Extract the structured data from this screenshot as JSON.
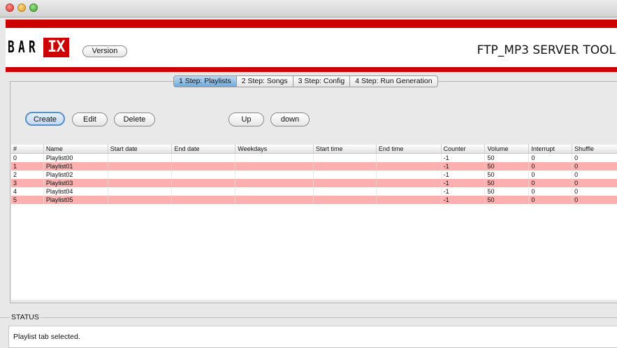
{
  "header": {
    "logo_letters": [
      "B",
      "A",
      "R"
    ],
    "logo_highlight": "IX",
    "version_label": "Version",
    "title": "FTP_MP3 SERVER TOOL"
  },
  "tabs": [
    {
      "label": "1 Step: Playlists",
      "selected": true
    },
    {
      "label": "2 Step: Songs",
      "selected": false
    },
    {
      "label": "3 Step: Config",
      "selected": false
    },
    {
      "label": "4 Step: Run Generation",
      "selected": false
    }
  ],
  "toolbar": {
    "create_label": "Create",
    "edit_label": "Edit",
    "delete_label": "Delete",
    "up_label": "Up",
    "down_label": "down"
  },
  "table": {
    "columns": [
      "#",
      "Name",
      "Start date",
      "End date",
      "Weekdays",
      "Start time",
      "End time",
      "Counter",
      "Volume",
      "Interrupt",
      "Shuffle"
    ],
    "rows": [
      [
        "0",
        "Playlist00",
        "",
        "",
        "",
        "",
        "",
        "-1",
        "50",
        "0",
        "0"
      ],
      [
        "1",
        "Playlist01",
        "",
        "",
        "",
        "",
        "",
        "-1",
        "50",
        "0",
        "0"
      ],
      [
        "2",
        "Playlist02",
        "",
        "",
        "",
        "",
        "",
        "-1",
        "50",
        "0",
        "0"
      ],
      [
        "3",
        "Playlist03",
        "",
        "",
        "",
        "",
        "",
        "-1",
        "50",
        "0",
        "0"
      ],
      [
        "4",
        "Playlist04",
        "",
        "",
        "",
        "",
        "",
        "-1",
        "50",
        "0",
        "0"
      ],
      [
        "5",
        "Playlist05",
        "",
        "",
        "",
        "",
        "",
        "-1",
        "50",
        "0",
        "0"
      ]
    ]
  },
  "status": {
    "label": "STATUS",
    "message": "Playlist tab selected."
  },
  "colors": {
    "brand_red": "#cc0000",
    "row_highlight": "#fcafaf",
    "tab_selected": "#6ea9dc"
  }
}
